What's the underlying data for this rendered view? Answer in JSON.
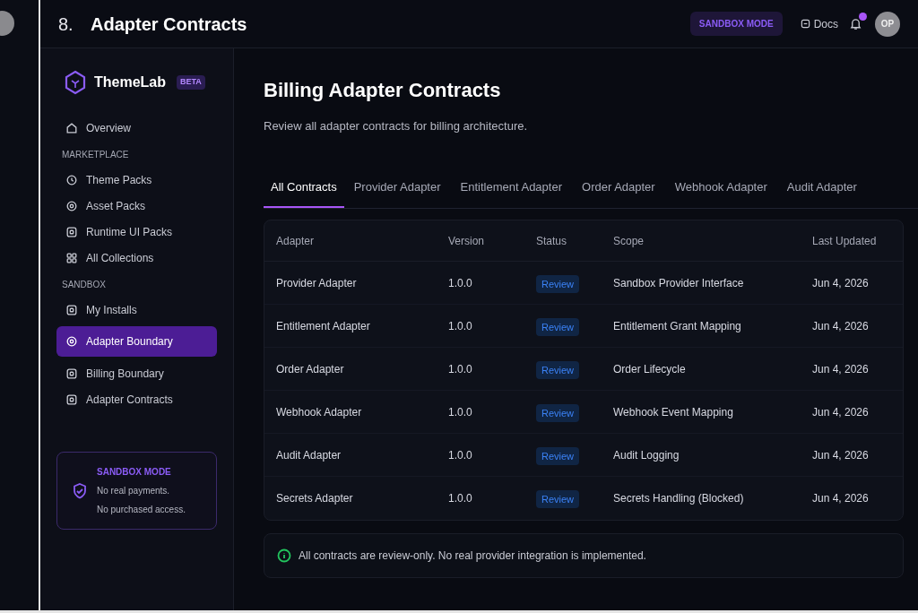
{
  "header": {
    "step": "8.",
    "title": "Adapter Contracts",
    "mode_badge": "SANDBOX MODE",
    "docs_link": "Docs",
    "notifications": {
      "unread": true
    },
    "avatar": "OP"
  },
  "sidebar": {
    "brand": "ThemeLab",
    "brand_badge": "BETA",
    "sections": [
      {
        "items": [
          {
            "label": "Overview",
            "selected": false
          }
        ]
      },
      {
        "heading": "MARKETPLACE",
        "items": [
          {
            "label": "Theme Packs",
            "selected": false
          },
          {
            "label": "Asset Packs",
            "selected": false
          },
          {
            "label": "Runtime UI Packs",
            "selected": false
          },
          {
            "label": "All Collections",
            "selected": false
          }
        ]
      },
      {
        "heading": "SANDBOX",
        "items": [
          {
            "label": "My Installs",
            "selected": false
          },
          {
            "label": "Adapter Boundary",
            "selected": true
          },
          {
            "label": "Billing Boundary",
            "selected": false
          },
          {
            "label": "Adapter Contracts",
            "selected": false
          }
        ]
      }
    ],
    "notice": {
      "title": "SANDBOX MODE",
      "lines": [
        "No real payments.",
        "No purchased access."
      ]
    }
  },
  "main": {
    "title": "Billing Adapter Contracts",
    "subtitle": "Review all adapter contracts for billing architecture.",
    "tabs": [
      {
        "label": "All Contracts",
        "selected": true
      },
      {
        "label": "Provider Adapter",
        "selected": false
      },
      {
        "label": "Entitlement Adapter",
        "selected": false
      },
      {
        "label": "Order Adapter",
        "selected": false
      },
      {
        "label": "Webhook Adapter",
        "selected": false
      },
      {
        "label": "Audit Adapter",
        "selected": false
      }
    ],
    "table": {
      "columns": [
        "Adapter",
        "Version",
        "Status",
        "Scope",
        "Last Updated"
      ],
      "rows": [
        {
          "adapter": "Provider Adapter",
          "version": "1.0.0",
          "status": "Review",
          "scope": "Sandbox Provider Interface",
          "updated": "Jun 4, 2026"
        },
        {
          "adapter": "Entitlement Adapter",
          "version": "1.0.0",
          "status": "Review",
          "scope": "Entitlement Grant Mapping",
          "updated": "Jun 4, 2026"
        },
        {
          "adapter": "Order Adapter",
          "version": "1.0.0",
          "status": "Review",
          "scope": "Order Lifecycle",
          "updated": "Jun 4, 2026"
        },
        {
          "adapter": "Webhook Adapter",
          "version": "1.0.0",
          "status": "Review",
          "scope": "Webhook Event Mapping",
          "updated": "Jun 4, 2026"
        },
        {
          "adapter": "Audit Adapter",
          "version": "1.0.0",
          "status": "Review",
          "scope": "Audit Logging",
          "updated": "Jun 4, 2026"
        },
        {
          "adapter": "Secrets Adapter",
          "version": "1.0.0",
          "status": "Review",
          "scope": "Secrets Handling (Blocked)",
          "updated": "Jun 4, 2026"
        }
      ]
    },
    "footer_note": "All contracts are review-only. No real provider integration is implemented."
  }
}
